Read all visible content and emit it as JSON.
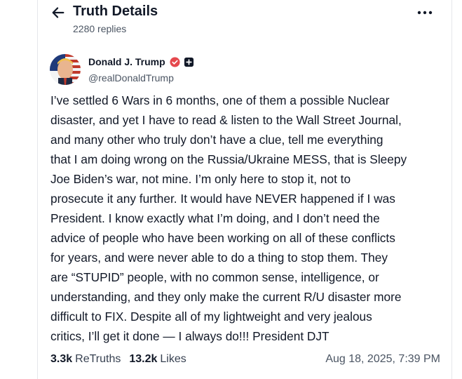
{
  "header": {
    "title": "Truth Details",
    "replies": "2280 replies",
    "back_icon": "arrow-left-icon",
    "more_icon": "more-horizontal-icon"
  },
  "author": {
    "name": "Donald J. Trump",
    "handle": "@realDonaldTrump",
    "verified_icon": "verified-badge-icon",
    "follow_icon": "plus-square-icon",
    "verified_color": "#e5484d"
  },
  "post": {
    "text": "I’ve settled 6 Wars in 6 months, one of them a possible Nuclear\ndisaster, and yet I have to read & listen to the Wall Street Journal,\nand many other who truly don’t have a clue, tell me everything\nthat I am doing wrong on the Russia/Ukraine MESS, that is Sleepy\nJoe Biden’s war, not mine. I’m only here to stop it, not to\nprosecute it any further. It would have NEVER happened if I was\nPresident. I know exactly what I’m doing, and I don’t need the\nadvice of people who have been working on all of these conflicts\nfor years, and were never able to do a thing to stop them. They\nare “STUPID” people, with no common sense, intelligence, or\nunderstanding, and they only make the current R/U disaster more\ndifficult to FIX. Despite all of my lightweight and very jealous\ncritics, I’ll get it done — I always do!!! President DJT"
  },
  "stats": {
    "retruths_count": "3.3k",
    "retruths_label": "ReTruths",
    "likes_count": "13.2k",
    "likes_label": "Likes",
    "timestamp": "Aug 18, 2025, 7:39 PM"
  }
}
